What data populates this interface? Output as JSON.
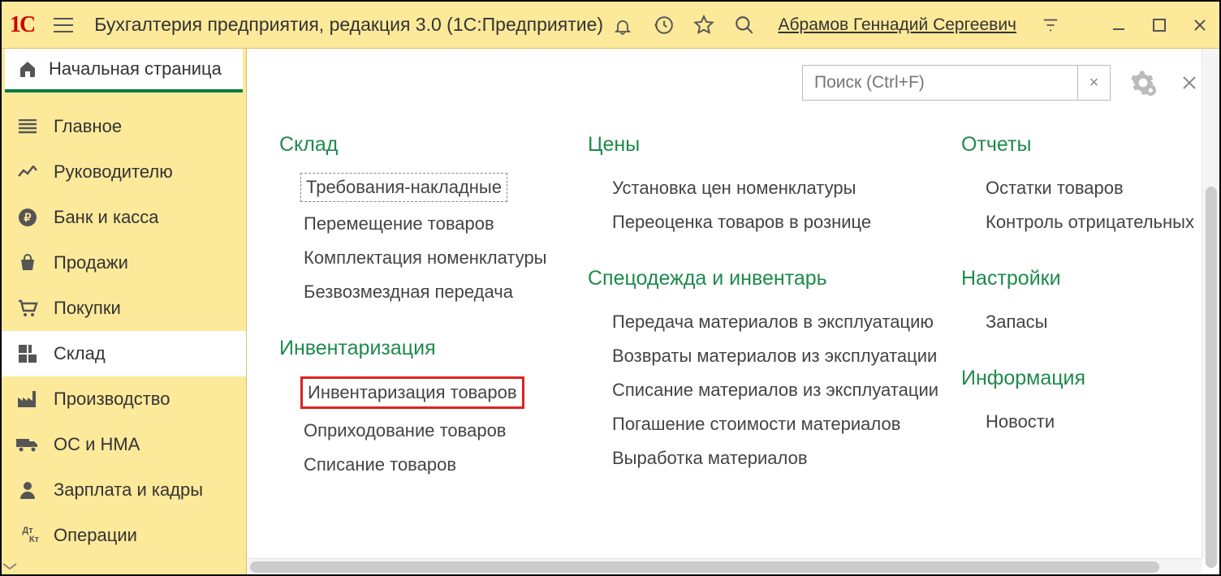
{
  "titlebar": {
    "title": "Бухгалтерия предприятия, редакция 3.0  (1С:Предприятие)",
    "user": "Абрамов Геннадий Сергеевич"
  },
  "sidebar": {
    "home": "Начальная страница",
    "items": [
      {
        "label": "Главное"
      },
      {
        "label": "Руководителю"
      },
      {
        "label": "Банк и касса"
      },
      {
        "label": "Продажи"
      },
      {
        "label": "Покупки"
      },
      {
        "label": "Склад"
      },
      {
        "label": "Производство"
      },
      {
        "label": "ОС и НМА"
      },
      {
        "label": "Зарплата и кадры"
      },
      {
        "label": "Операции"
      }
    ]
  },
  "search": {
    "placeholder": "Поиск (Ctrl+F)"
  },
  "content": {
    "col1": {
      "sect1": {
        "head": "Склад",
        "items": [
          "Требования-накладные",
          "Перемещение товаров",
          "Комплектация номенклатуры",
          "Безвозмездная передача"
        ]
      },
      "sect2": {
        "head": "Инвентаризация",
        "items": [
          "Инвентаризация товаров",
          "Оприходование товаров",
          "Списание товаров"
        ]
      }
    },
    "col2": {
      "sect1": {
        "head": "Цены",
        "items": [
          "Установка цен номенклатуры",
          "Переоценка товаров в рознице"
        ]
      },
      "sect2": {
        "head": "Спецодежда и инвентарь",
        "items": [
          "Передача материалов в эксплуатацию",
          "Возвраты материалов из эксплуатации",
          "Списание материалов из эксплуатации",
          "Погашение стоимости материалов",
          "Выработка материалов"
        ]
      }
    },
    "col3": {
      "sect1": {
        "head": "Отчеты",
        "items": [
          "Остатки товаров",
          "Контроль отрицательных"
        ]
      },
      "sect2": {
        "head": "Настройки",
        "items": [
          "Запасы"
        ]
      },
      "sect3": {
        "head": "Информация",
        "items": [
          "Новости"
        ]
      }
    }
  }
}
